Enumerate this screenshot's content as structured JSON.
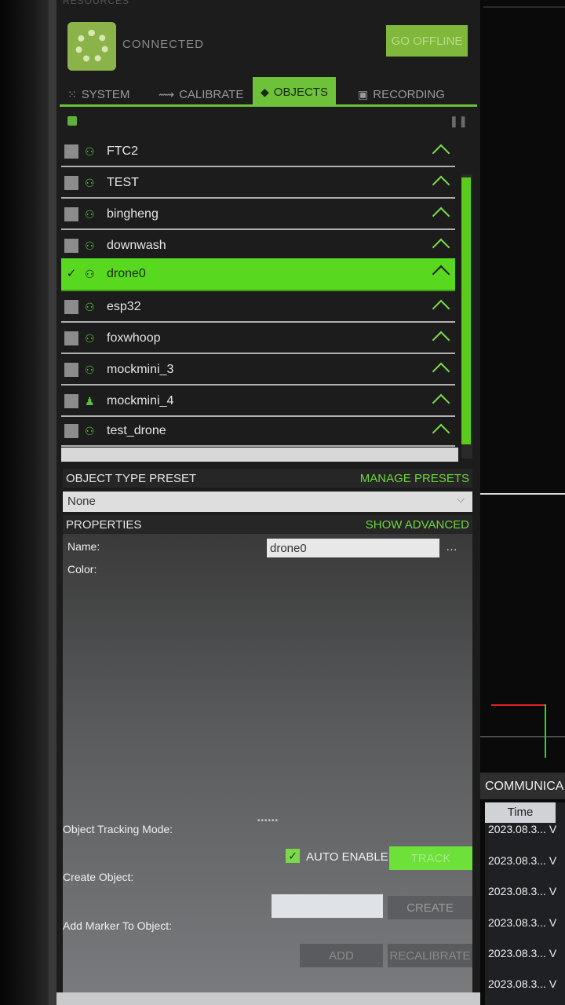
{
  "resources": {
    "label": "RESOURCES"
  },
  "connection": {
    "status": "CONNECTED",
    "go_offline": "GO OFFLINE"
  },
  "tabs": [
    {
      "label": "SYSTEM",
      "icon": "system-icon"
    },
    {
      "label": "CALIBRATE",
      "icon": "calibrate-icon"
    },
    {
      "label": "OBJECTS",
      "icon": "objects-icon",
      "active": true
    },
    {
      "label": "RECORDING",
      "icon": "recording-icon"
    }
  ],
  "objects": [
    {
      "name": "FTC2",
      "checked": false
    },
    {
      "name": "TEST",
      "checked": false
    },
    {
      "name": "bingheng",
      "checked": false
    },
    {
      "name": "downwash",
      "checked": false
    },
    {
      "name": "drone0",
      "checked": true,
      "selected": true
    },
    {
      "name": "esp32",
      "checked": false
    },
    {
      "name": "foxwhoop",
      "checked": false
    },
    {
      "name": "mockmini_3",
      "checked": false
    },
    {
      "name": "mockmini_4",
      "checked": false
    },
    {
      "name": "test_drone",
      "checked": false
    }
  ],
  "preset": {
    "title": "OBJECT TYPE PRESET",
    "action": "MANAGE PRESETS",
    "value": "None"
  },
  "properties": {
    "title": "PROPERTIES",
    "action": "SHOW ADVANCED",
    "name_label": "Name:",
    "name_value": "drone0",
    "color_label": "Color:"
  },
  "tracking": {
    "mode_label": "Object Tracking Mode:",
    "auto_enable": "AUTO ENABLE",
    "track": "TRACK",
    "create_label": "Create Object:",
    "create": "CREATE",
    "add_marker_label": "Add Marker To Object:",
    "add": "ADD",
    "recalibrate": "RECALIBRATE"
  },
  "comm": {
    "title": "COMMUNICA",
    "time_col": "Time",
    "rows": [
      "2023.08.3...",
      "2023.08.3...",
      "2023.08.3...",
      "2023.08.3...",
      "2023.08.3...",
      "2023.08.3..."
    ],
    "row_suffix": "V"
  },
  "colors": {
    "accent": "#6ec23a",
    "selected_row": "#58d81e"
  }
}
